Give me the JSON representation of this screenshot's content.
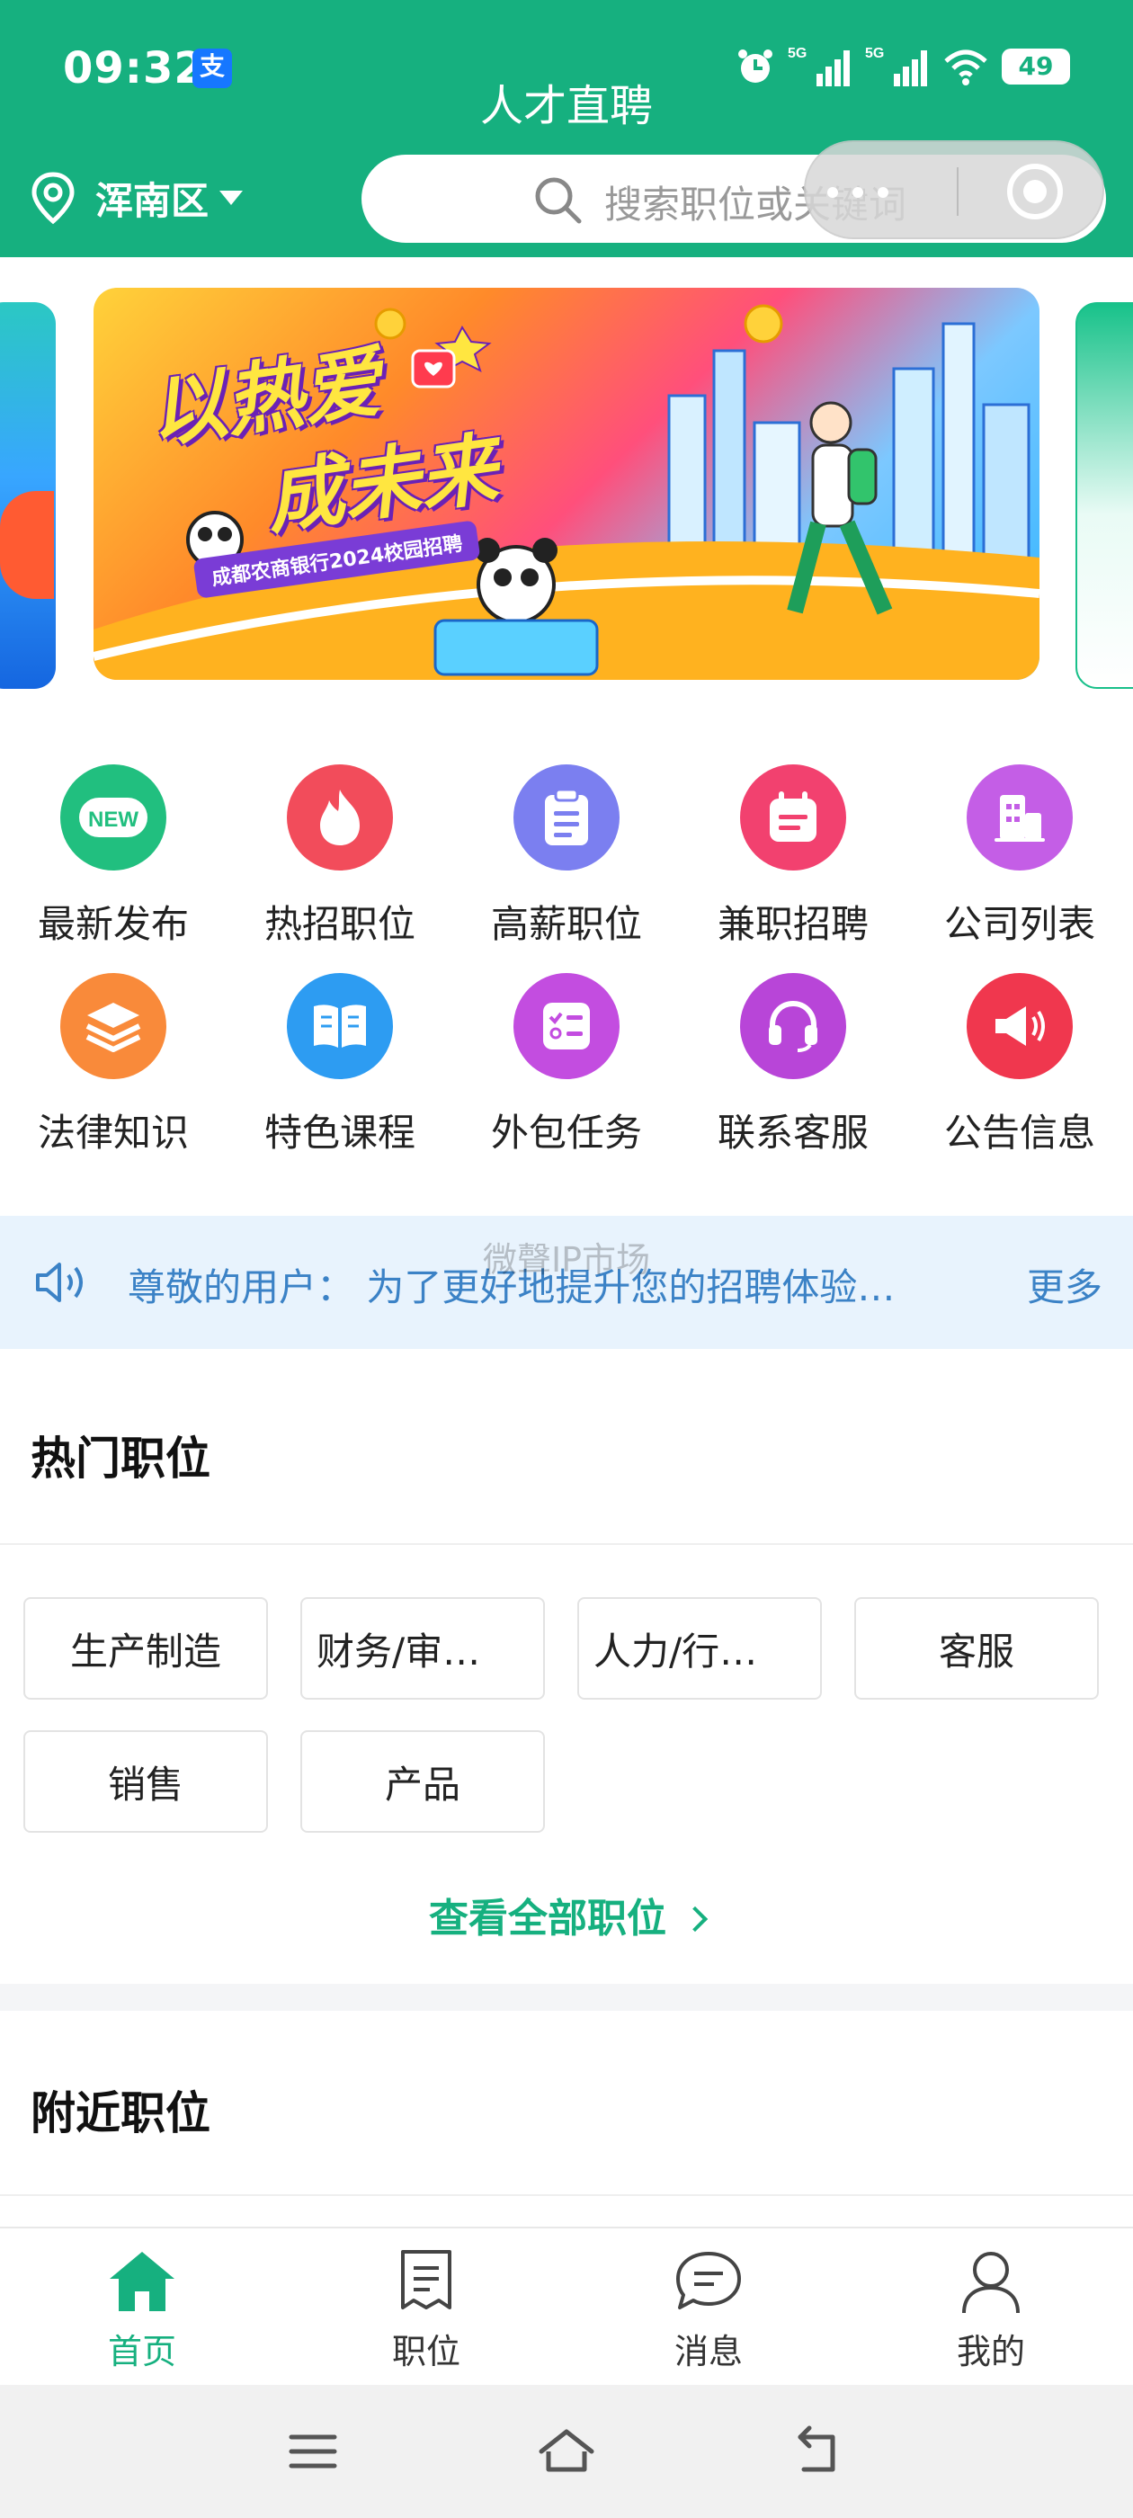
{
  "status_bar": {
    "time": "09:32",
    "app_badge": "支",
    "network_1": "5G",
    "network_2": "5G",
    "battery": "49"
  },
  "header": {
    "title": "人才直聘",
    "location": "浑南区",
    "search_placeholder": "搜索职位或关键词"
  },
  "banner": {
    "headline_line1": "以热爱",
    "headline_line2": "成未来",
    "subline": "成都农商银行2024校园招聘"
  },
  "grid": {
    "items": [
      {
        "label": "最新发布",
        "icon": "new-icon",
        "color": "#21bf7f"
      },
      {
        "label": "热招职位",
        "icon": "flame-icon",
        "color": "#f24c5b"
      },
      {
        "label": "高薪职位",
        "icon": "clipboard-icon",
        "color": "#7b7ff0"
      },
      {
        "label": "兼职招聘",
        "icon": "calendar-icon",
        "color": "#f2416f"
      },
      {
        "label": "公司列表",
        "icon": "building-icon",
        "color": "#c45ee6"
      },
      {
        "label": "法律知识",
        "icon": "layers-icon",
        "color": "#f98a3a"
      },
      {
        "label": "特色课程",
        "icon": "book-icon",
        "color": "#2d9cf2"
      },
      {
        "label": "外包任务",
        "icon": "checklist-icon",
        "color": "#c34de0"
      },
      {
        "label": "联系客服",
        "icon": "headset-icon",
        "color": "#b845d8"
      },
      {
        "label": "公告信息",
        "icon": "megaphone-icon",
        "color": "#f0374e"
      }
    ]
  },
  "notice": {
    "text": "尊敬的用户：  为了更好地提升您的招聘体验…",
    "more": "更多",
    "watermark": "微聲IP市场"
  },
  "hot_jobs": {
    "title": "热门职位",
    "tags": [
      "生产制造",
      "财务/审…",
      "人力/行…",
      "客服",
      "销售",
      "产品"
    ],
    "view_all": "查看全部职位"
  },
  "nearby": {
    "title": "附近职位"
  },
  "tabbar": {
    "items": [
      {
        "label": "首页",
        "icon": "home-icon",
        "active": true
      },
      {
        "label": "职位",
        "icon": "document-icon",
        "active": false
      },
      {
        "label": "消息",
        "icon": "chat-icon",
        "active": false
      },
      {
        "label": "我的",
        "icon": "user-icon",
        "active": false
      }
    ]
  },
  "colors": {
    "brand": "#16b07f",
    "notice_bg": "#e8f3fd",
    "notice_text": "#3b82c6"
  }
}
